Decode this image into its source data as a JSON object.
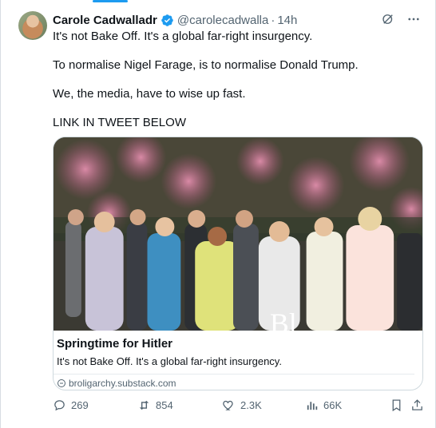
{
  "tweet": {
    "author_name": "Carole Cadwalladr",
    "handle": "@carolecadwalla",
    "separator": "·",
    "time": "14h",
    "lines": [
      "It's not Bake Off. It's a global far-right insurgency.",
      "To normalise Nigel Farage, is to normalise Donald Trump.",
      "We, the media, have to wise up fast.",
      "LINK IN TWEET BELOW"
    ]
  },
  "card": {
    "title": "Springtime for Hitler",
    "description": "It's not Bake Off. It's a global far-right insurgency.",
    "domain": "broligarchy.substack.com",
    "image_overlay_text": "Bl"
  },
  "actions": {
    "replies": "269",
    "reposts": "854",
    "likes": "2.3K",
    "views": "66K"
  },
  "colors": {
    "accent": "#1d9bf0",
    "text_secondary": "#536471",
    "border": "#cfd9de"
  },
  "icons": [
    "verified-icon",
    "grok-icon",
    "more-icon",
    "link-icon",
    "reply-icon",
    "repost-icon",
    "like-icon",
    "views-icon",
    "bookmark-icon",
    "share-icon"
  ]
}
